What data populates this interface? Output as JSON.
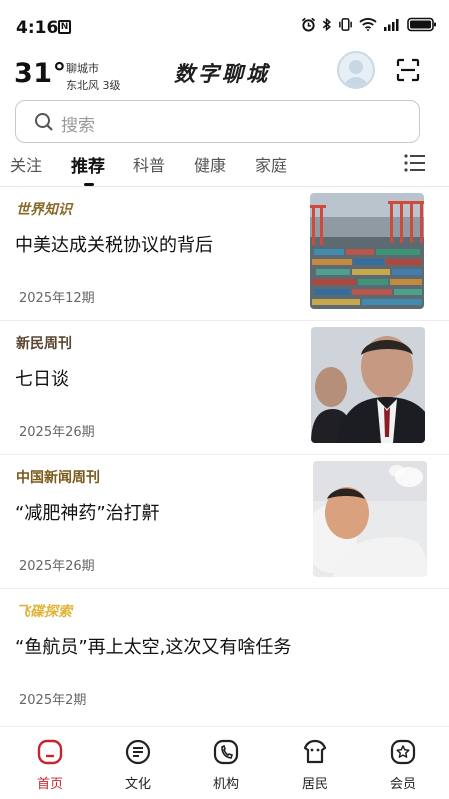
{
  "status_bar": {
    "time": "4:16",
    "n_badge": "N",
    "icons": [
      "alarm-icon",
      "bluetooth-icon",
      "vibrate-icon",
      "wifi-icon",
      "signal-icon",
      "battery-icon"
    ]
  },
  "header": {
    "temperature": "31°",
    "city": "聊城市",
    "wind": "东北风  3级",
    "brand": "数字聊城",
    "avatar_icon": "user-avatar",
    "scan_icon": "scan-icon"
  },
  "search": {
    "placeholder": "搜索"
  },
  "tabs": {
    "items": [
      {
        "label": "关注"
      },
      {
        "label": "推荐"
      },
      {
        "label": "科普"
      },
      {
        "label": "健康"
      },
      {
        "label": "家庭"
      }
    ],
    "active_index": 1,
    "menu_icon": "menu-list-icon"
  },
  "articles": [
    {
      "publication": "世界知识",
      "headline": "中美达成关税协议的背后",
      "issue": "2025年12期",
      "pub_color": "#8a6a2a",
      "image": "container-port-photo"
    },
    {
      "publication": "新民周刊",
      "headline": "七日谈",
      "issue": "2025年26期",
      "pub_color": "#5a4632",
      "image": "politician-photo"
    },
    {
      "publication": "中国新闻周刊",
      "headline": "“减肥神药”治打鼾",
      "issue": "2025年26期",
      "pub_color": "#7a5a1a",
      "image": "snoring-man-photo"
    },
    {
      "publication": "飞碟探索",
      "headline": "“鱼航员”再上太空,这次又有啥任务",
      "issue": "2025年2期",
      "pub_color": "#e0b43a",
      "image": ""
    }
  ],
  "bottom_nav": {
    "items": [
      {
        "label": "首页",
        "icon": "home-icon"
      },
      {
        "label": "文化",
        "icon": "culture-icon"
      },
      {
        "label": "机构",
        "icon": "phone-icon"
      },
      {
        "label": "居民",
        "icon": "resident-icon"
      },
      {
        "label": "会员",
        "icon": "member-icon"
      }
    ],
    "active_index": 0,
    "accent_color": "#c3262b"
  }
}
